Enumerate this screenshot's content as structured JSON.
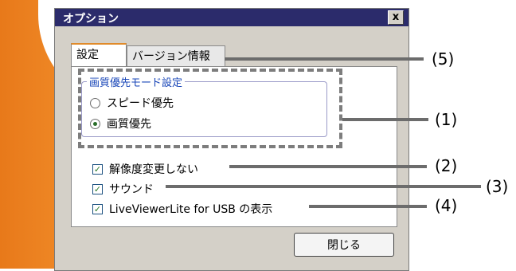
{
  "window": {
    "title": "オプション",
    "close_glyph": "x"
  },
  "tabs": [
    {
      "label": "設定",
      "active": true
    },
    {
      "label": "バージョン情報",
      "active": false
    }
  ],
  "image_quality_group": {
    "legend": "画質優先モード設定",
    "options": [
      {
        "label": "スピード優先",
        "selected": false
      },
      {
        "label": "画質優先",
        "selected": true
      }
    ]
  },
  "checkboxes": [
    {
      "label": "解像度変更しない",
      "checked": true
    },
    {
      "label": "サウンド",
      "checked": true
    },
    {
      "label": "LiveViewerLite for USB の表示",
      "checked": true
    }
  ],
  "close_button": "閉じる",
  "callouts": {
    "c1": "(1)",
    "c2": "(2)",
    "c3": "(3)",
    "c4": "(4)",
    "c5": "(5)"
  },
  "colors": {
    "accent_orange": "#e8791a",
    "titlebar": "#2b2b6b",
    "legend_blue": "#1a47b8"
  }
}
